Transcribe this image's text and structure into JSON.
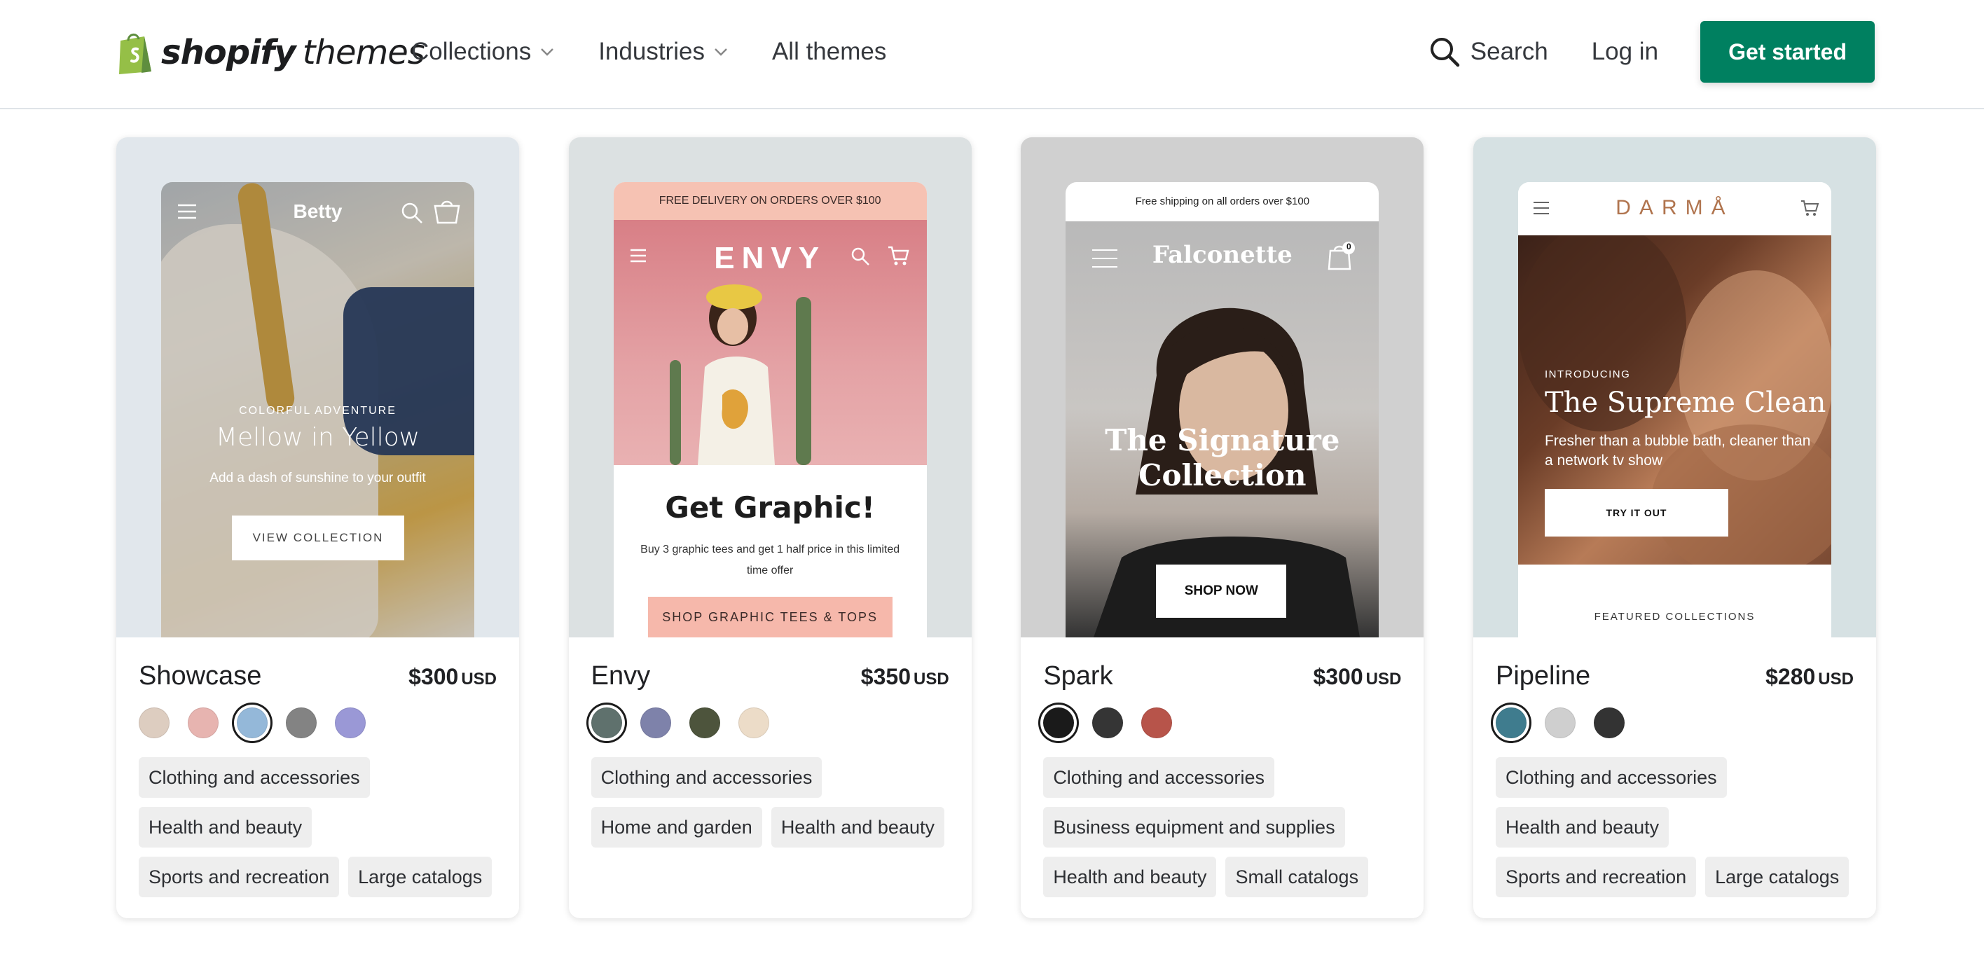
{
  "header": {
    "logo_word": "shopify",
    "logo_suffix": "themes",
    "nav": [
      {
        "label": "Collections",
        "has_dropdown": true
      },
      {
        "label": "Industries",
        "has_dropdown": true
      },
      {
        "label": "All themes",
        "has_dropdown": false
      }
    ],
    "search_label": "Search",
    "login_label": "Log in",
    "cta_label": "Get started",
    "brand_color": "#008060"
  },
  "cards": [
    {
      "name": "Showcase",
      "price": "$300",
      "currency": "USD",
      "preview_bg": "#e1e7ec",
      "preview": {
        "brand": "Betty",
        "cart_count": "0",
        "eyebrow": "COLORFUL ADVENTURE",
        "heading": "Mellow in Yellow",
        "subtext": "Add a dash of sunshine to your outfit",
        "button": "VIEW COLLECTION"
      },
      "swatches": [
        "#ddcdc0",
        "#e7b4b0",
        "#94b8d9",
        "#838383",
        "#9a98d6"
      ],
      "selected_swatch": 2,
      "tags": [
        "Clothing and accessories",
        "Health and beauty",
        "Sports and recreation",
        "Large catalogs"
      ]
    },
    {
      "name": "Envy",
      "price": "$350",
      "currency": "USD",
      "preview_bg": "#dce1e2",
      "preview": {
        "announcement": "FREE DELIVERY ON ORDERS OVER $100",
        "brand": "ENVY",
        "heading": "Get Graphic!",
        "subtext": "Buy 3 graphic tees and get 1 half price in this limited time offer",
        "button": "SHOP GRAPHIC TEES & TOPS"
      },
      "swatches": [
        "#5f716d",
        "#7e82aa",
        "#4d543c",
        "#ecdcc8"
      ],
      "selected_swatch": 0,
      "tags": [
        "Clothing and accessories",
        "Home and garden",
        "Health and beauty"
      ]
    },
    {
      "name": "Spark",
      "price": "$300",
      "currency": "USD",
      "preview_bg": "#d0d0d0",
      "preview": {
        "announcement": "Free shipping on all orders over $100",
        "brand": "Falconette",
        "cart_count": "0",
        "heading": "The Signature Collection",
        "button": "SHOP NOW"
      },
      "swatches": [
        "#1a1a1a",
        "#353535",
        "#b7544a"
      ],
      "selected_swatch": 0,
      "tags": [
        "Clothing and accessories",
        "Business equipment and supplies",
        "Health and beauty",
        "Small catalogs"
      ]
    },
    {
      "name": "Pipeline",
      "price": "$280",
      "currency": "USD",
      "preview_bg": "#d6e1e3",
      "preview": {
        "brand": "DARMÅ",
        "eyebrow": "INTRODUCING",
        "heading": "The Supreme Clean",
        "subtext": "Fresher than a bubble bath, cleaner than a network tv show",
        "button": "TRY IT OUT",
        "footer": "FEATURED COLLECTIONS"
      },
      "swatches": [
        "#3f7c8e",
        "#cfcfcf",
        "#333333"
      ],
      "selected_swatch": 0,
      "tags": [
        "Clothing and accessories",
        "Health and beauty",
        "Sports and recreation",
        "Large catalogs"
      ]
    }
  ]
}
